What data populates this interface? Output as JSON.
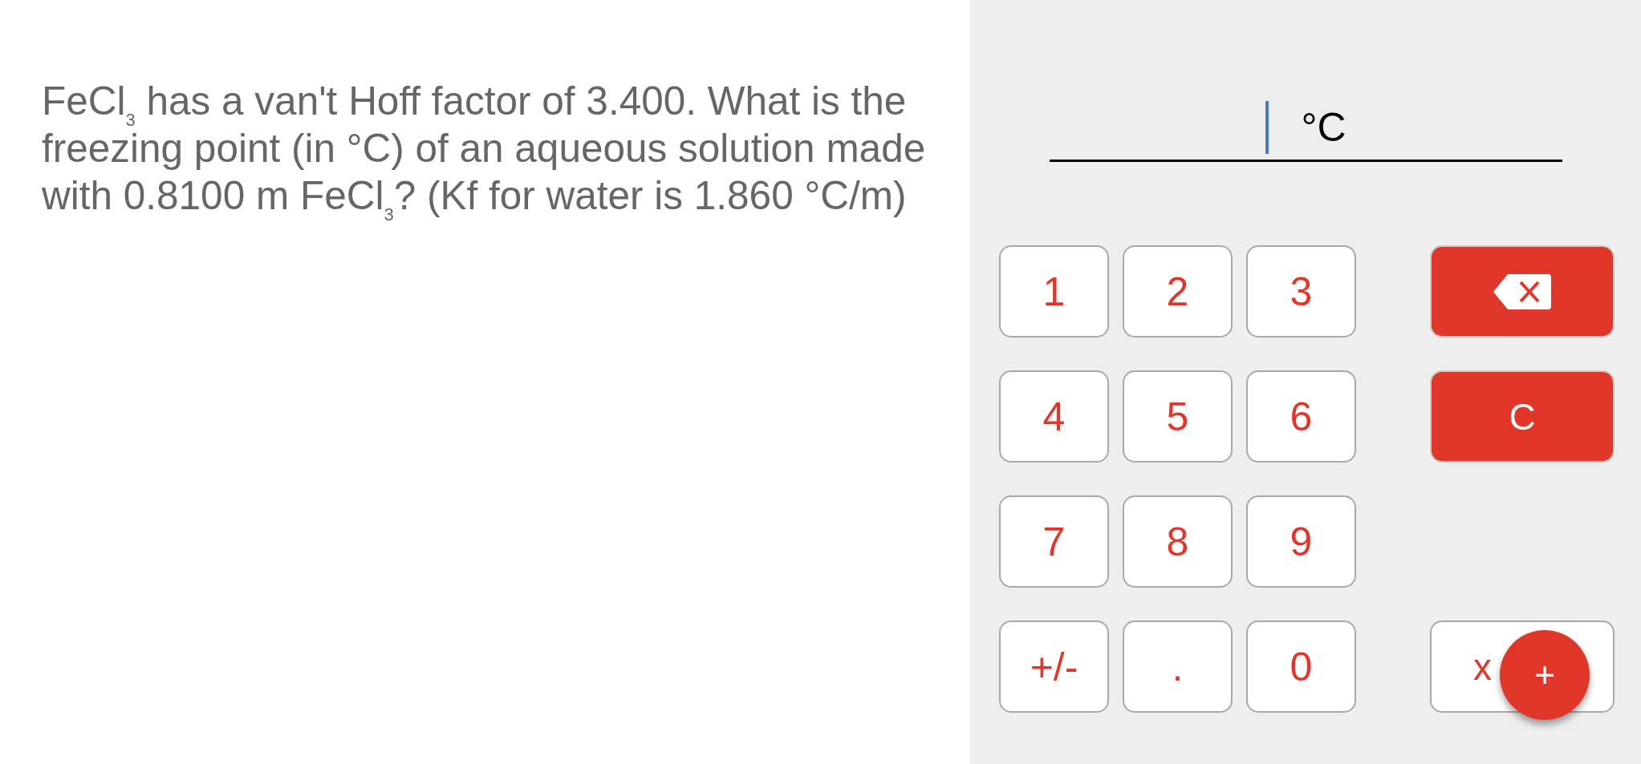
{
  "question": "FeCl$_{3}$ has a van't Hoff factor of 3.400. What is the freezing point (in °C) of an aqueous solution made with 0.8100 m FeCl$_{3}$? (Kf for water is 1.860 °C/m)",
  "answer": {
    "unit": "°C",
    "focused": true
  },
  "keypad": [
    {
      "digits": [
        "1",
        "2",
        "3"
      ],
      "side": {
        "kind": "backspace"
      }
    },
    {
      "digits": [
        "4",
        "5",
        "6"
      ],
      "side": {
        "kind": "clear",
        "label": "C"
      }
    },
    {
      "digits": [
        "7",
        "8",
        "9"
      ]
    },
    {
      "digits": [
        "+/-",
        ".",
        "0"
      ],
      "side": {
        "kind": "exponent",
        "label": "x"
      }
    }
  ],
  "fab": {
    "label": "+"
  }
}
